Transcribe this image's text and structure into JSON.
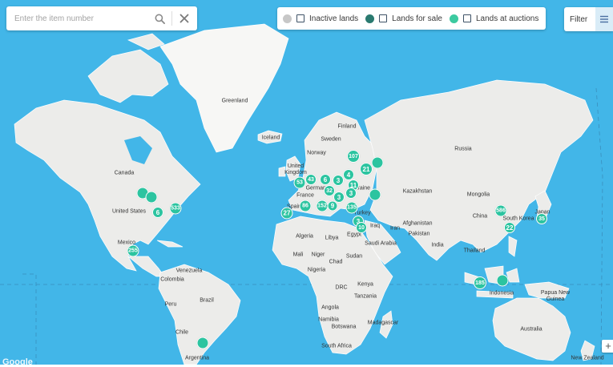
{
  "search": {
    "placeholder": "Enter the item number"
  },
  "legend": {
    "items": [
      {
        "label": "Inactive lands",
        "color": "#c7c7c7"
      },
      {
        "label": "Lands for sale",
        "color": "#2a7a70"
      },
      {
        "label": "Lands at auctions",
        "color": "#3ccaa0"
      }
    ]
  },
  "filter": {
    "label": "Filter"
  },
  "zoom": {
    "in_label": "+"
  },
  "attribution": {
    "logo_text": "Google"
  },
  "map": {
    "countries": [
      "Greenland",
      "Iceland",
      "Finland",
      "Sweden",
      "Norway",
      "United Kingdom",
      "Germany",
      "France",
      "Spain",
      "Ukraine",
      "Turkey",
      "Russia",
      "Kazakhstan",
      "Mongolia",
      "China",
      "South Korea",
      "Japan",
      "Afghanistan",
      "Iran",
      "Iraq",
      "Pakistan",
      "India",
      "Saudi Arabia",
      "Egypt",
      "Libya",
      "Algeria",
      "Mali",
      "Niger",
      "Chad",
      "Sudan",
      "Nigeria",
      "Kenya",
      "DRC",
      "Tanzania",
      "Angola",
      "Namibia",
      "Botswana",
      "Madagascar",
      "South Africa",
      "Thailand",
      "Indonesia",
      "Papua New Guinea",
      "Australia",
      "Canada",
      "United States",
      "Mexico",
      "Venezuela",
      "Colombia",
      "Peru",
      "Brazil",
      "Chile",
      "Argentina",
      "New Zealand"
    ],
    "cluster_counts": [
      "107",
      "21",
      "43",
      "6",
      "3",
      "4",
      "53",
      "11",
      "32",
      "3",
      "3",
      "27",
      "86",
      "152",
      "9",
      "135",
      "3",
      "10",
      "533",
      "6",
      "255",
      "586",
      "35",
      "22",
      "185"
    ]
  }
}
